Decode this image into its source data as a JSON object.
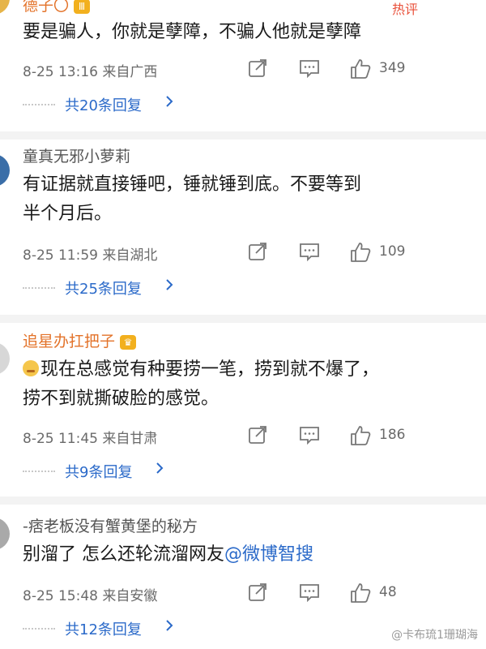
{
  "comments": [
    {
      "username": "德子〇",
      "body_lines": [
        "要是骗人，你就是孽障，不骗人他就是孽障"
      ],
      "time": "8-25 13:16",
      "location": "来自广西",
      "likes": "349",
      "replies": "共20条回复",
      "hot": "热评"
    },
    {
      "username": "童真无邪小萝莉",
      "body_lines": [
        "有证据就直接锤吧，锤就锤到底。不要等到",
        "半个月后。"
      ],
      "time": "8-25 11:59",
      "location": "来自湖北",
      "likes": "109",
      "replies": "共25条回复"
    },
    {
      "username": "追星办扛把子",
      "body_lines": [
        "现在总感觉有种要捞一笔，捞到就不爆了，",
        "捞不到就撕破脸的感觉。"
      ],
      "time": "8-25 11:45",
      "location": "来自甘肃",
      "likes": "186",
      "replies": "共9条回复"
    },
    {
      "username": "-痞老板没有蟹黄堡的秘方",
      "body_prefix": "别溜了 怎么还轮流溜网友",
      "mention": "@微博智搜",
      "time": "8-25 15:48",
      "location": "来自安徽",
      "likes": "48",
      "replies": "共12条回复"
    }
  ],
  "watermark": "@卡布琉1珊瑚海",
  "colors": {
    "link": "#2b6ac9",
    "vip_name": "#e3732a",
    "hot": "#e9503a"
  },
  "icons": [
    "share-icon",
    "comment-icon",
    "like-icon",
    "chevron-right-icon",
    "emoji-icon",
    "avatar"
  ]
}
